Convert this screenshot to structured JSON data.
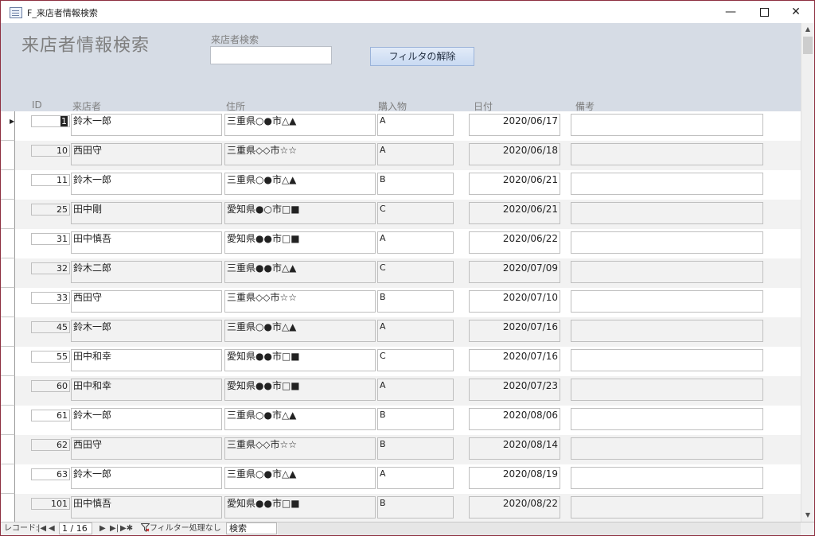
{
  "window": {
    "title": "F_来店者情報検索",
    "minimize": "—",
    "close": "✕"
  },
  "form": {
    "title": "来店者情報検索",
    "search_label": "来店者検索",
    "search_value": "",
    "filter_button": "フィルタの解除"
  },
  "columns": {
    "id": "ID",
    "name": "来店者",
    "address": "住所",
    "item": "購入物",
    "date": "日付",
    "note": "備考"
  },
  "rows": [
    {
      "id": "1",
      "name": "鈴木一郎",
      "address": "三重県○●市△▲",
      "item": "A",
      "date": "2020/06/17",
      "note": ""
    },
    {
      "id": "10",
      "name": "西田守",
      "address": "三重県◇◇市☆☆",
      "item": "A",
      "date": "2020/06/18",
      "note": ""
    },
    {
      "id": "11",
      "name": "鈴木一郎",
      "address": "三重県○●市△▲",
      "item": "B",
      "date": "2020/06/21",
      "note": ""
    },
    {
      "id": "25",
      "name": "田中剛",
      "address": "愛知県●○市□■",
      "item": "C",
      "date": "2020/06/21",
      "note": ""
    },
    {
      "id": "31",
      "name": "田中慎吾",
      "address": "愛知県●●市□■",
      "item": "A",
      "date": "2020/06/22",
      "note": ""
    },
    {
      "id": "32",
      "name": "鈴木二郎",
      "address": "三重県●●市△▲",
      "item": "C",
      "date": "2020/07/09",
      "note": ""
    },
    {
      "id": "33",
      "name": "西田守",
      "address": "三重県◇◇市☆☆",
      "item": "B",
      "date": "2020/07/10",
      "note": ""
    },
    {
      "id": "45",
      "name": "鈴木一郎",
      "address": "三重県○●市△▲",
      "item": "A",
      "date": "2020/07/16",
      "note": ""
    },
    {
      "id": "55",
      "name": "田中和幸",
      "address": "愛知県●●市□■",
      "item": "C",
      "date": "2020/07/16",
      "note": ""
    },
    {
      "id": "60",
      "name": "田中和幸",
      "address": "愛知県●●市□■",
      "item": "A",
      "date": "2020/07/23",
      "note": ""
    },
    {
      "id": "61",
      "name": "鈴木一郎",
      "address": "三重県○●市△▲",
      "item": "B",
      "date": "2020/08/06",
      "note": ""
    },
    {
      "id": "62",
      "name": "西田守",
      "address": "三重県◇◇市☆☆",
      "item": "B",
      "date": "2020/08/14",
      "note": ""
    },
    {
      "id": "63",
      "name": "鈴木一郎",
      "address": "三重県○●市△▲",
      "item": "A",
      "date": "2020/08/19",
      "note": ""
    },
    {
      "id": "101",
      "name": "田中慎吾",
      "address": "愛知県●●市□■",
      "item": "B",
      "date": "2020/08/22",
      "note": ""
    }
  ],
  "navigation": {
    "record_label": "レコード:",
    "first": "|◀",
    "prev": "◀",
    "position": "1 / 16",
    "next": "▶",
    "last": "▶|",
    "new": "▶✱",
    "filter_status": "フィルター処理なし",
    "search_value": "検索"
  },
  "scrollbar": {
    "up": "▲",
    "down": "▼"
  },
  "icons": [
    "form-icon",
    "filter-icon",
    "row-pointer-icon"
  ]
}
